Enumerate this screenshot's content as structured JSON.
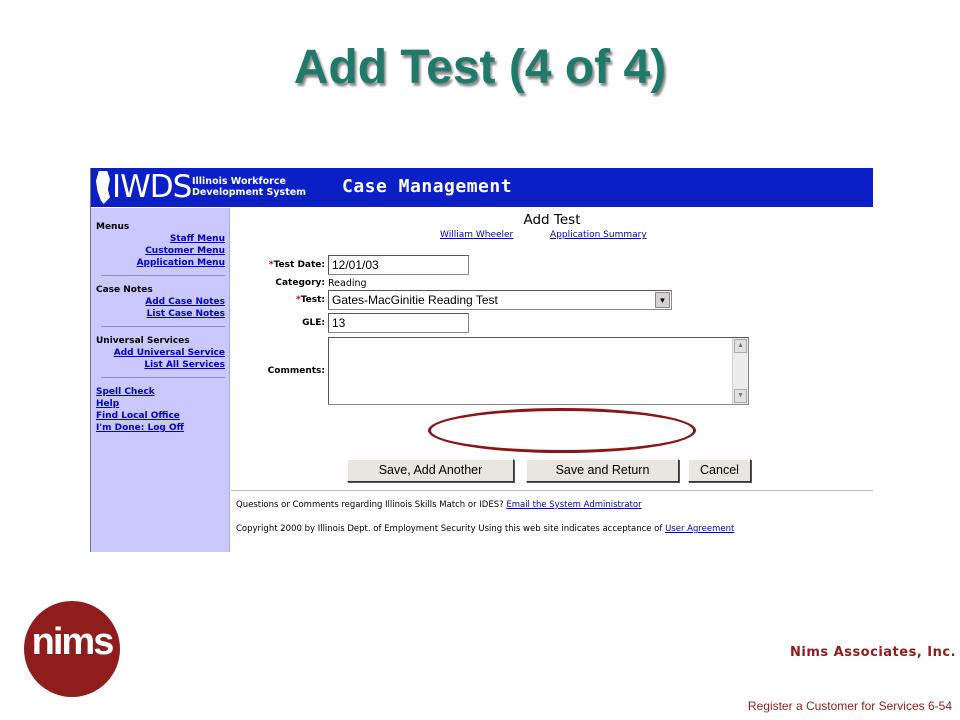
{
  "slide": {
    "title": "Add Test (4 of 4)",
    "company": "Nims Associates, Inc.",
    "logo_text": "nims",
    "footer": "Register a Customer for Services 6-54"
  },
  "banner": {
    "logo": "IWDS",
    "agency_line1": "Illinois Workforce",
    "agency_line2": "Development System",
    "title": "Case Management",
    "color": "#0b1fc7"
  },
  "sidebar": {
    "menus": {
      "title": "Menus",
      "items": [
        "Staff Menu",
        "Customer Menu",
        "Application Menu"
      ]
    },
    "case_notes": {
      "title": "Case Notes",
      "items": [
        "Add Case Notes",
        "List Case Notes"
      ]
    },
    "universal": {
      "title": "Universal Services",
      "items": [
        "Add Universal Service",
        "List All Services"
      ]
    },
    "extras": [
      "Spell Check",
      "Help",
      "Find Local Office",
      "I'm Done: Log Off"
    ],
    "color": "#c9c9ff"
  },
  "form": {
    "title": "Add Test",
    "links": [
      "William Wheeler",
      "Application Summary"
    ],
    "test_date": {
      "label": "Test Date:",
      "value": "12/01/03",
      "required": "*"
    },
    "category": {
      "label": "Category:",
      "value": "Reading"
    },
    "test": {
      "label": "Test:",
      "value": "Gates-MacGinitie Reading Test",
      "required": "*"
    },
    "gle": {
      "label": "GLE:",
      "value": "13"
    },
    "comments": {
      "label": "Comments:",
      "value": ""
    },
    "buttons": {
      "save_add": "Save, Add Another",
      "save_return": "Save and Return",
      "cancel": "Cancel"
    }
  },
  "footer": {
    "question": "Questions or Comments regarding Illinois Skills Match or IDES?",
    "email_link": "Email the System Administrator",
    "copyright": "Copyright 2000 by Illinois Dept. of Employment Security Using this web site indicates acceptance of",
    "agreement_link": "User Agreement"
  },
  "colors": {
    "title": "#1f7a6a",
    "accent": "#8e1d1c",
    "link": "#0000cc"
  }
}
